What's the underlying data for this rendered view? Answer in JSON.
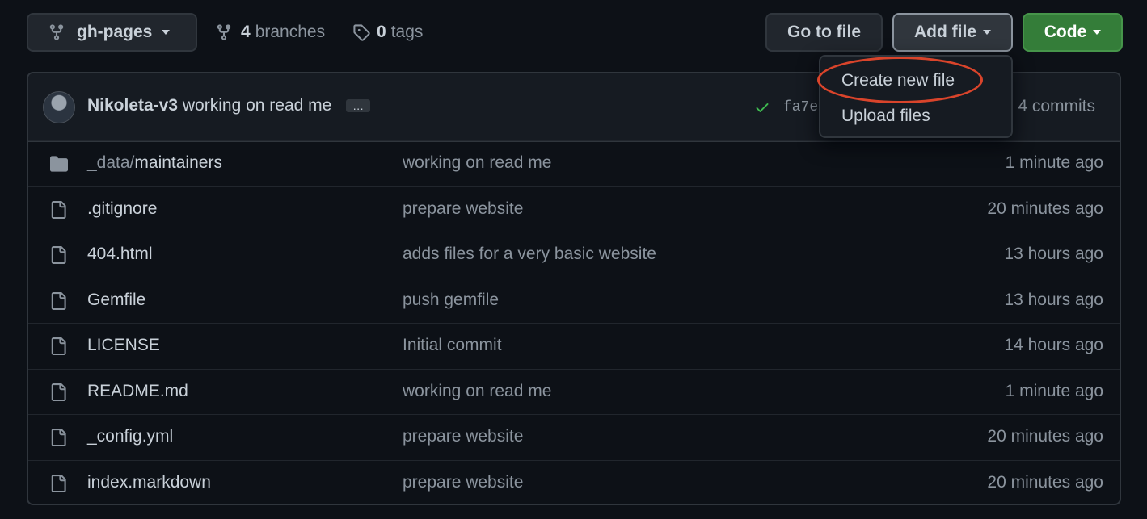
{
  "toolbar": {
    "branch_label": "gh-pages",
    "branches_count": "4",
    "branches_label": "branches",
    "tags_count": "0",
    "tags_label": "tags",
    "go_to_file_label": "Go to file",
    "add_file_label": "Add file",
    "code_label": "Code",
    "code_color": "#347d39"
  },
  "commit": {
    "author": "Nikoleta-v3",
    "message": "working on read me",
    "ellipsis": "…",
    "sha": "fa7e",
    "commits_label": "4 commits",
    "status_color": "#3fb950"
  },
  "dropdown": {
    "items": [
      {
        "label": "Create new file",
        "highlighted": true
      },
      {
        "label": "Upload files"
      }
    ],
    "highlight_color": "#d9442b"
  },
  "files": [
    {
      "type": "folder-icon",
      "dir": "_data/",
      "name": "maintainers",
      "message": "working on read me",
      "age": "1 minute ago"
    },
    {
      "type": "file-icon",
      "dir": "",
      "name": ".gitignore",
      "message": "prepare website",
      "age": "20 minutes ago"
    },
    {
      "type": "file-icon",
      "dir": "",
      "name": "404.html",
      "message": "adds files for a very basic website",
      "age": "13 hours ago"
    },
    {
      "type": "file-icon",
      "dir": "",
      "name": "Gemfile",
      "message": "push gemfile",
      "age": "13 hours ago"
    },
    {
      "type": "file-icon",
      "dir": "",
      "name": "LICENSE",
      "message": "Initial commit",
      "age": "14 hours ago"
    },
    {
      "type": "file-icon",
      "dir": "",
      "name": "README.md",
      "message": "working on read me",
      "age": "1 minute ago"
    },
    {
      "type": "file-icon",
      "dir": "",
      "name": "_config.yml",
      "message": "prepare website",
      "age": "20 minutes ago"
    },
    {
      "type": "file-icon",
      "dir": "",
      "name": "index.markdown",
      "message": "prepare website",
      "age": "20 minutes ago"
    }
  ]
}
